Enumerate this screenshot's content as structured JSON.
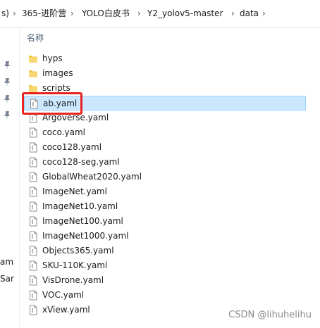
{
  "breadcrumb": {
    "items": [
      "s)",
      "365-进阶营",
      "YOLO白皮书",
      "Y2_yolov5-master",
      "data"
    ],
    "separator": "›"
  },
  "nav": {
    "labels": [
      "am",
      "Sar"
    ]
  },
  "list": {
    "column_header": "名称",
    "folders": [
      "hyps",
      "images",
      "scripts"
    ],
    "files": [
      "ab.yaml",
      "Argoverse.yaml",
      "coco.yaml",
      "coco128.yaml",
      "coco128-seg.yaml",
      "GlobalWheat2020.yaml",
      "ImageNet.yaml",
      "ImageNet10.yaml",
      "ImageNet100.yaml",
      "ImageNet1000.yaml",
      "Objects365.yaml",
      "SKU-110K.yaml",
      "VisDrone.yaml",
      "VOC.yaml",
      "xView.yaml"
    ],
    "selected_file": "ab.yaml"
  },
  "watermark": "CSDN @lihuhelihu",
  "colors": {
    "selection_bg": "#cce8ff",
    "selection_border": "#99d1ff",
    "highlight": "#e8231f",
    "folder": "#f3c44b"
  },
  "icons": {
    "folder": "folder-icon",
    "file": "yaml-file-icon",
    "pin": "pin-icon"
  }
}
